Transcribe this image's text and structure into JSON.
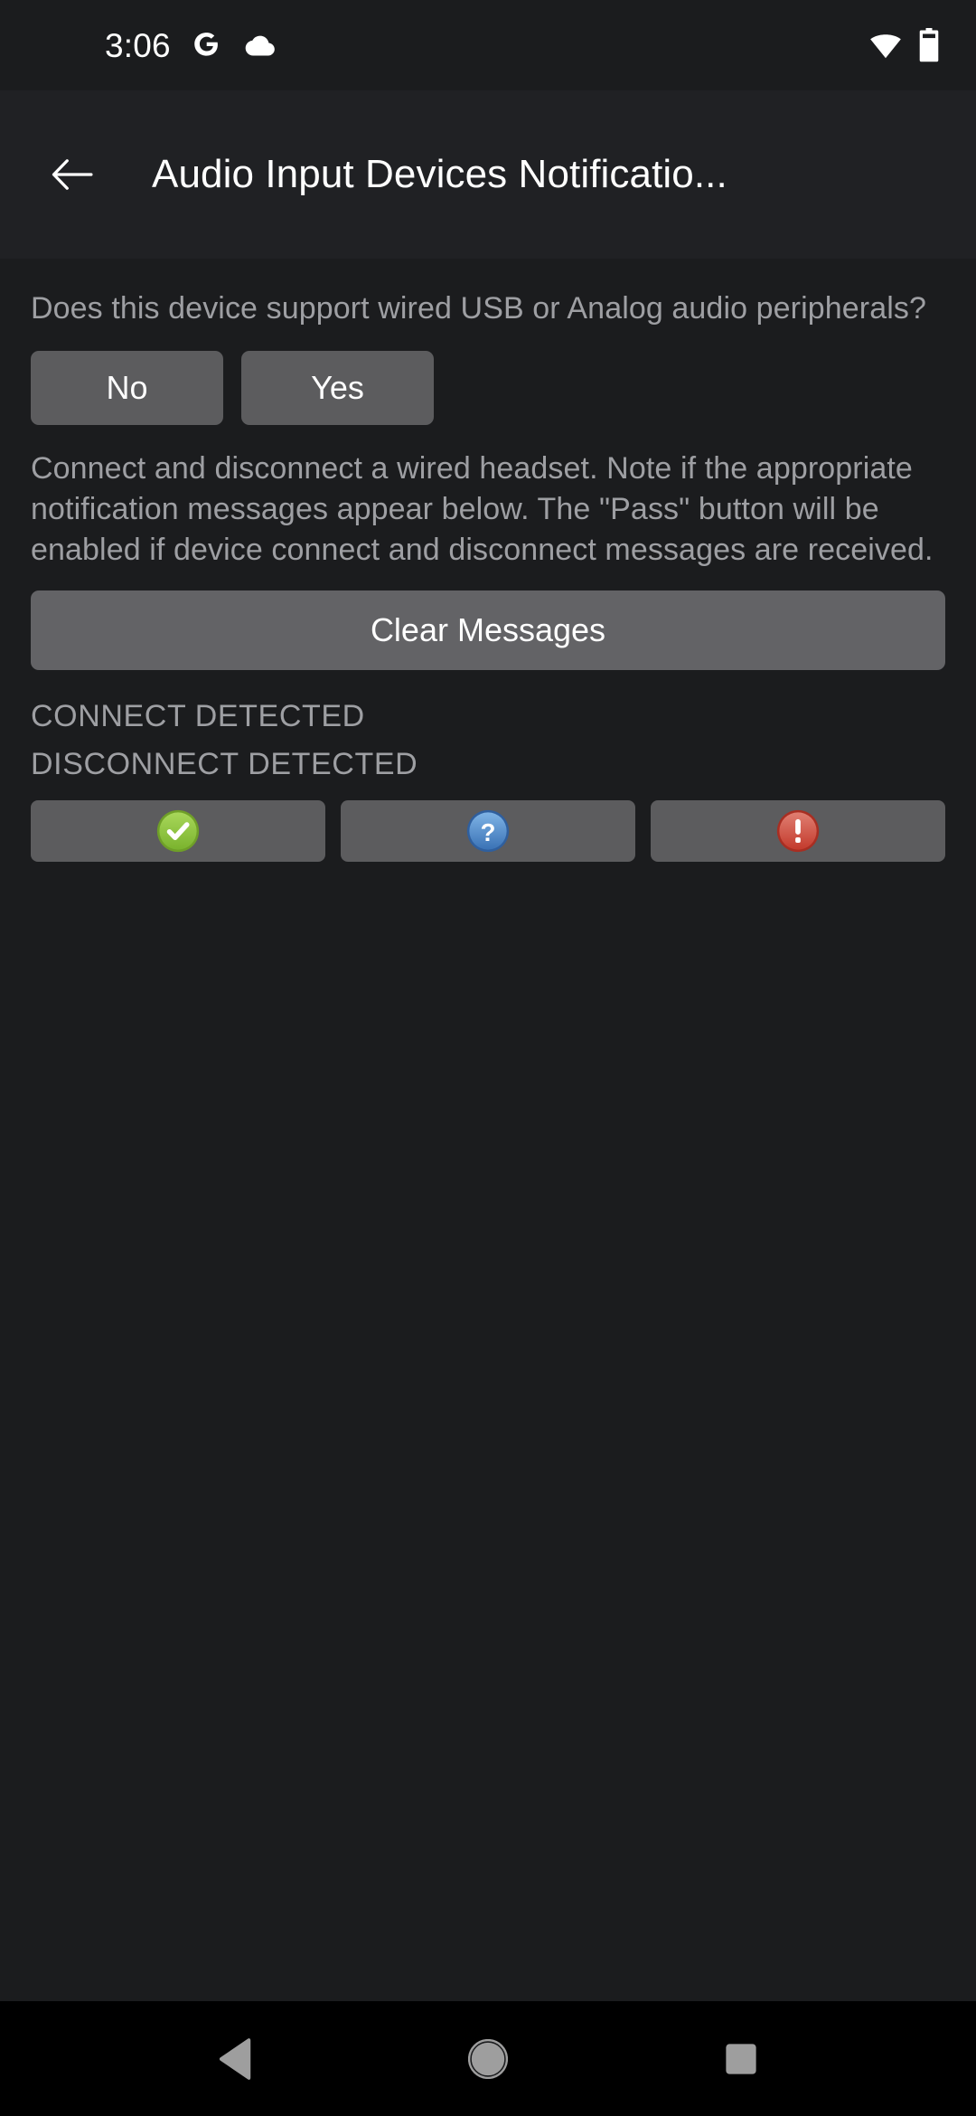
{
  "status_bar": {
    "clock": "3:06",
    "left_icons": [
      "google-g-icon",
      "cloud-icon"
    ],
    "right_icons": [
      "wifi-icon",
      "battery-icon"
    ]
  },
  "app_bar": {
    "back_icon": "back-arrow-icon",
    "title": "Audio Input Devices Notificatio..."
  },
  "content": {
    "question": "Does this device support wired USB or Analog audio peripherals?",
    "no_label": "No",
    "yes_label": "Yes",
    "instruction": "Connect and disconnect a wired headset. Note if the appropriate notification messages appear below. The \"Pass\" button will be enabled if device connect and disconnect messages are received.",
    "clear_label": "Clear Messages",
    "messages": [
      "CONNECT DETECTED",
      "DISCONNECT DETECTED"
    ],
    "verdict_buttons": [
      {
        "name": "pass-button",
        "icon": "check-circle-icon"
      },
      {
        "name": "info-button",
        "icon": "question-circle-icon"
      },
      {
        "name": "fail-button",
        "icon": "exclamation-circle-icon"
      }
    ]
  },
  "nav_bar": {
    "back": "nav-back-icon",
    "home": "nav-home-icon",
    "recents": "nav-recents-icon"
  },
  "colors": {
    "background": "#1b1c1e",
    "app_bar": "#202124",
    "button": "#5c5c5e",
    "clear_button": "#636366",
    "text_primary": "#ffffff",
    "text_secondary": "#9e9fa3",
    "pass_green": "#8cc63f",
    "info_blue": "#4a90d9",
    "fail_red": "#d9534f",
    "nav_bar": "#000000"
  }
}
